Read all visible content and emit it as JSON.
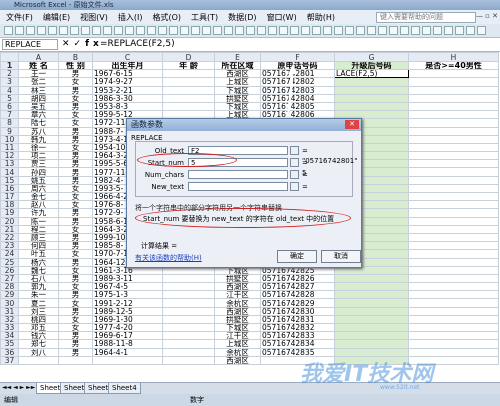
{
  "window": {
    "title": "Microsoft Excel - 原始文件.xls"
  },
  "menu": [
    "文件(F)",
    "编辑(E)",
    "视图(V)",
    "插入(I)",
    "格式(O)",
    "工具(T)",
    "数据(D)",
    "窗口(W)",
    "帮助(H)"
  ],
  "help_placeholder": "键入需要帮助的问题",
  "namebox": "REPLACE",
  "formula": "=REPLACE(F2,5)",
  "columns": [
    "A",
    "B",
    "C",
    "D",
    "E",
    "F",
    "G",
    "H"
  ],
  "header_row": [
    "姓 名",
    "性 别",
    "出生年月",
    "年 龄",
    "所在区域",
    "原电话号码",
    "升级后号码",
    "是否>=40男性"
  ],
  "rows": [
    [
      "王一",
      "男",
      "1967-6-15",
      "",
      "西湖区",
      "05716742801",
      "LACE(F2,5)"
    ],
    [
      "张二",
      "女",
      "1974-9-27",
      "",
      "上城区",
      "05716742802",
      ""
    ],
    [
      "林三",
      "男",
      "1953-2-21",
      "",
      "下城区",
      "05716742803",
      ""
    ],
    [
      "胡四",
      "女",
      "1986-3-30",
      "",
      "拱墅区",
      "05716742804",
      ""
    ],
    [
      "吴五",
      "男",
      "1953-8-3",
      "",
      "下城区",
      "05716742805",
      ""
    ],
    [
      "章六",
      "女",
      "1959-5-12",
      "",
      "上城区",
      "05716742806",
      ""
    ],
    [
      "陆七",
      "女",
      "1972-11-",
      "",
      "",
      "",
      ""
    ],
    [
      "苏八",
      "男",
      "1988-7-",
      "",
      "",
      "",
      ""
    ],
    [
      "韩九",
      "男",
      "1973-4-1",
      "",
      "",
      "",
      ""
    ],
    [
      "徐一",
      "女",
      "1954-10-",
      "",
      "",
      "",
      ""
    ],
    [
      "项二",
      "男",
      "1964-3-2",
      "",
      "",
      "",
      ""
    ],
    [
      "贾三",
      "男",
      "1995-5-6",
      "",
      "",
      "",
      ""
    ],
    [
      "孙四",
      "男",
      "1977-11-",
      "",
      "",
      "",
      ""
    ],
    [
      "姚五",
      "男",
      "1982-4-",
      "",
      "",
      "",
      ""
    ],
    [
      "周六",
      "女",
      "1993-5-",
      "",
      "",
      "",
      ""
    ],
    [
      "金七",
      "女",
      "1966-4-2",
      "",
      "",
      "",
      ""
    ],
    [
      "赵八",
      "女",
      "1976-8-",
      "",
      "",
      "",
      ""
    ],
    [
      "许九",
      "男",
      "1972-9-",
      "",
      "",
      "",
      ""
    ],
    [
      "陈一",
      "男",
      "1958-6-1",
      "",
      "",
      "",
      ""
    ],
    [
      "程二",
      "女",
      "1964-3-2",
      "",
      "",
      "",
      ""
    ],
    [
      "顾三",
      "男",
      "1999-10-",
      "",
      "",
      "",
      ""
    ],
    [
      "何四",
      "男",
      "1985-8-",
      "",
      "",
      "",
      ""
    ],
    [
      "叶五",
      "女",
      "1970-7-19",
      "",
      "西湖区",
      "05716742823",
      ""
    ],
    [
      "杨六",
      "男",
      "1964-12-21",
      "",
      "余杭区",
      "05716742824",
      ""
    ],
    [
      "魏七",
      "女",
      "1961-3-16",
      "",
      "下城区",
      "05716742825",
      ""
    ],
    [
      "石八",
      "男",
      "1989-3-11",
      "",
      "拱墅区",
      "05716742826",
      ""
    ],
    [
      "郭九",
      "女",
      "1967-4-5",
      "",
      "西湖区",
      "05716742827",
      ""
    ],
    [
      "朱一",
      "男",
      "1975-1-3",
      "",
      "江干区",
      "05716742828",
      ""
    ],
    [
      "夏二",
      "女",
      "1991-2-12",
      "",
      "余杭区",
      "05716742829",
      ""
    ],
    [
      "刘三",
      "男",
      "1989-12-5",
      "",
      "西湖区",
      "05716742830",
      ""
    ],
    [
      "桃四",
      "女",
      "1969-1-30",
      "",
      "拱墅区",
      "05716742831",
      ""
    ],
    [
      "邓五",
      "女",
      "1977-4-20",
      "",
      "下城区",
      "05716742832",
      ""
    ],
    [
      "钱六",
      "男",
      "1969-6-17",
      "",
      "江干区",
      "05716742833",
      ""
    ],
    [
      "郑七",
      "男",
      "1988-11-8",
      "",
      "上城区",
      "05716742834",
      ""
    ],
    [
      "刘八",
      "男",
      "1964-4-1",
      "",
      "余杭区",
      "05716742835",
      ""
    ],
    [
      "",
      "",
      "",
      "",
      "西湖区",
      "",
      ""
    ]
  ],
  "dialog": {
    "title": "函数参数",
    "function": "REPLACE",
    "args": [
      {
        "label": "Old_text",
        "value": "F2",
        "result": "= \"05716742801\""
      },
      {
        "label": "Start_num",
        "value": "5",
        "result": "= 5"
      },
      {
        "label": "Num_chars",
        "value": "",
        "result": "="
      },
      {
        "label": "New_text",
        "value": "",
        "result": "="
      }
    ],
    "description": "将一个字符串中的部分字符用另一个字符串替换",
    "arg_help": "Start_num  要替换为 new_text 的字符在 old_text 中的位置",
    "calc_result": "计算结果 =",
    "help_link": "有关该函数的帮助(H)",
    "ok": "确定",
    "cancel": "取消"
  },
  "sheets": [
    "Sheet1",
    "Sheet2",
    "Sheet3",
    "Sheet4"
  ],
  "status": {
    "mode": "编辑",
    "num": "数字"
  },
  "watermark": "我爱IT技术网",
  "watermark_url": "www.52it.net"
}
